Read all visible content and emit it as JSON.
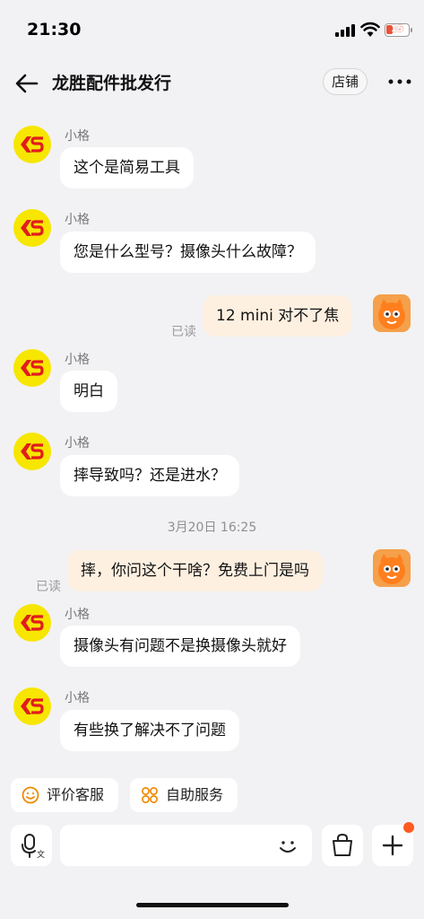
{
  "status_bar": {
    "time": "21:30",
    "battery": "15"
  },
  "header": {
    "title": "龙胜配件批发行",
    "shop_button": "店铺"
  },
  "messages": [
    {
      "sender": "小格",
      "text": "这个是简易工具"
    },
    {
      "sender": "小格",
      "text": "您是什么型号？摄像头什么故障？"
    },
    {
      "text": "12 mini 对不了焦",
      "read": "已读"
    },
    {
      "sender": "小格",
      "text": "明白"
    },
    {
      "sender": "小格",
      "text": "摔导致吗？还是进水？"
    },
    {
      "timestamp": "3月20日 16:25"
    },
    {
      "text": "摔，你问这个干啥？免费上门是吗",
      "read": "已读"
    },
    {
      "sender": "小格",
      "text": "摄像头有问题不是换摄像头就好"
    },
    {
      "sender": "小格",
      "text": "有些换了解决不了问题"
    }
  ],
  "quick_actions": {
    "rate": "评价客服",
    "self_service": "自助服务"
  },
  "colors": {
    "avatar_bg": "#f7e600",
    "logo_red": "#e11d1d",
    "outgoing_bubble": "#fdf0e1",
    "accent": "#ff5a1f"
  }
}
